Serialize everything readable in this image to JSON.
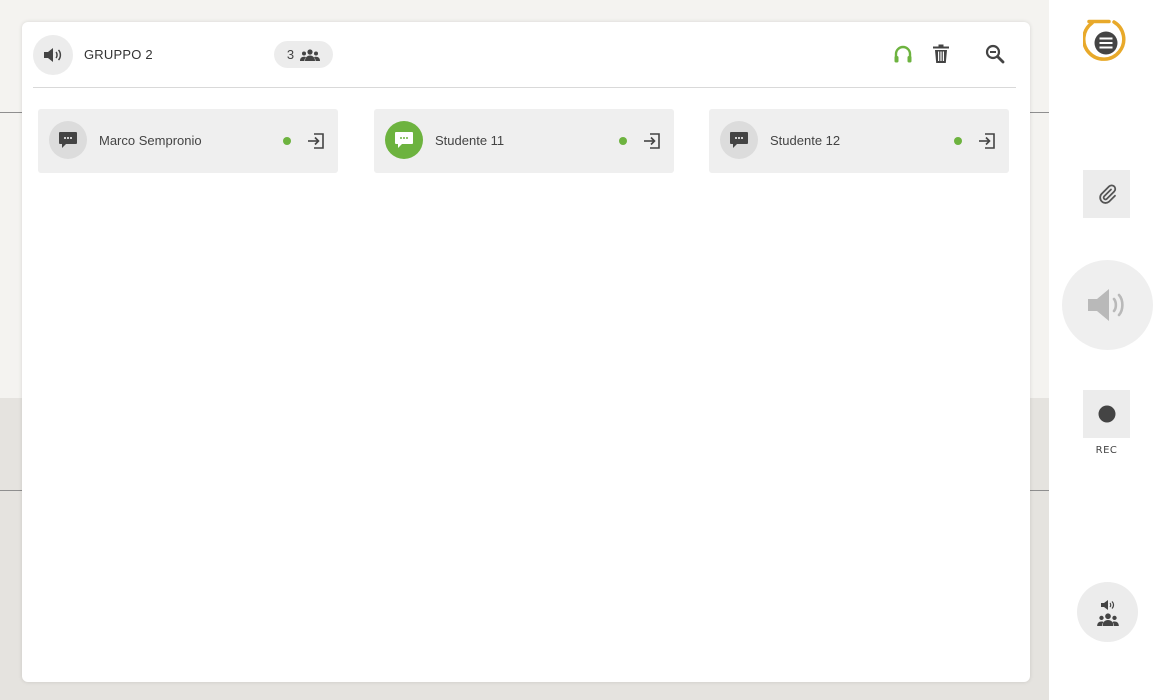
{
  "group": {
    "name": "GRUPPO 2",
    "member_count": "3"
  },
  "header_icons": [
    "speaker-icon",
    "group-icon",
    "headphones-icon",
    "trash-icon",
    "zoom-out-icon"
  ],
  "members": [
    {
      "name": "Marco Sempronio",
      "online": true,
      "chat_active": false
    },
    {
      "name": "Studente 11",
      "online": true,
      "chat_active": true
    },
    {
      "name": "Studente 12",
      "online": true,
      "chat_active": false
    }
  ],
  "sidebar": {
    "rec_label": "REC"
  },
  "colors": {
    "accent_green": "#6db33f",
    "menu_ring": "#e8a92a",
    "icon_gray": "#444444",
    "icon_light": "#b9b9b9"
  }
}
